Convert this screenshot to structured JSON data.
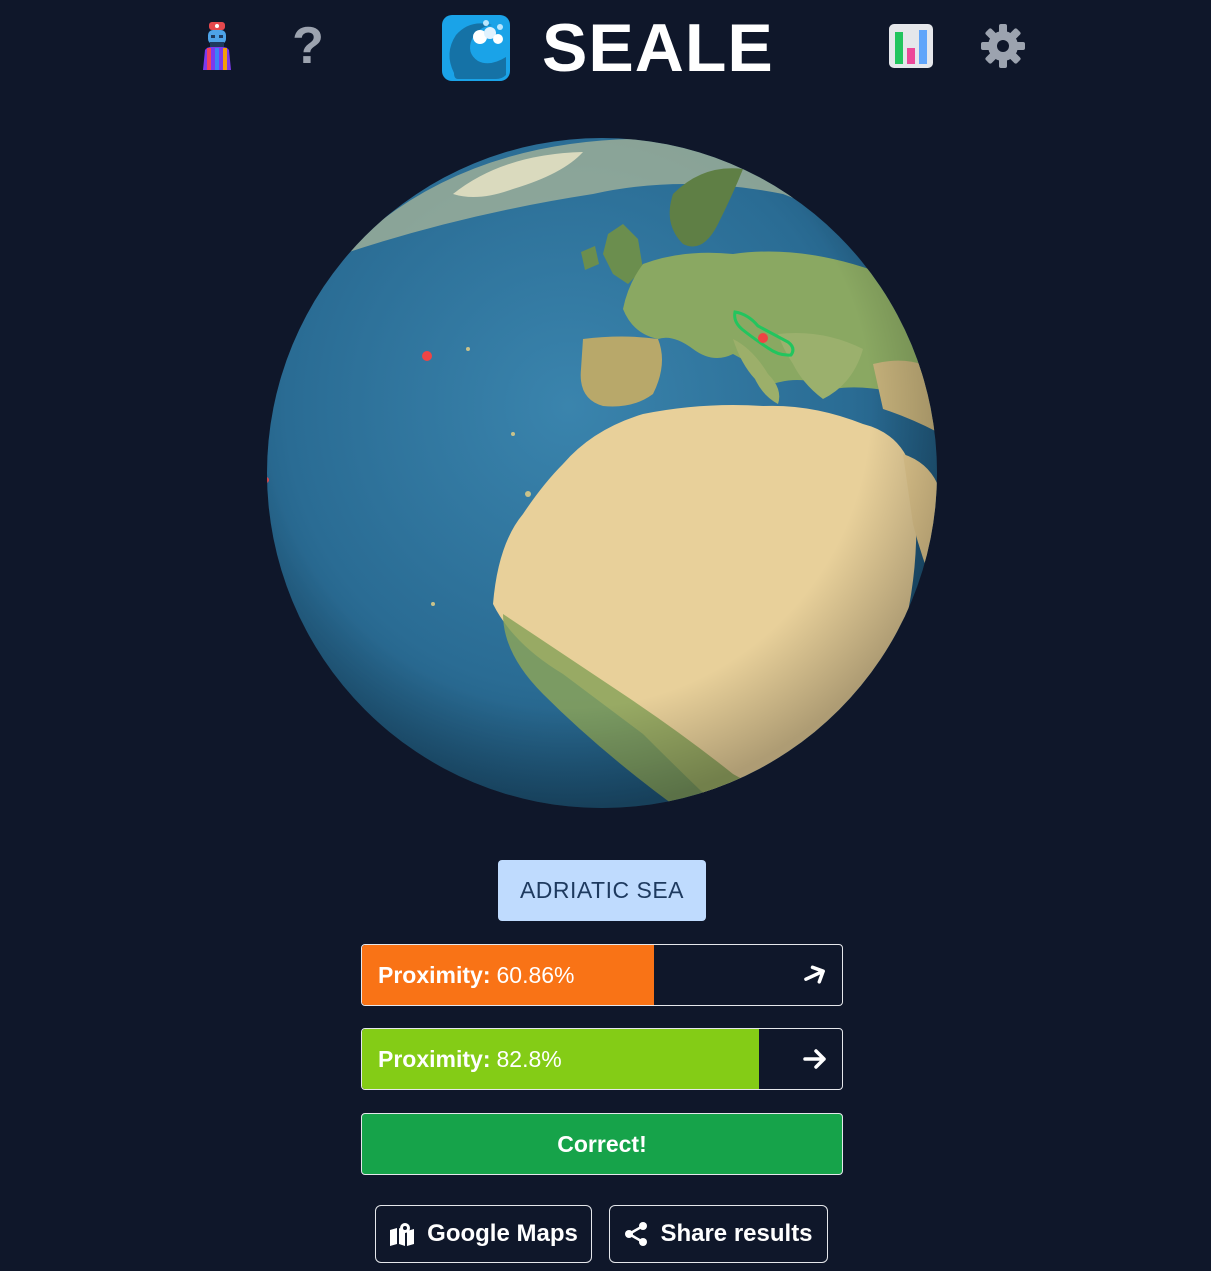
{
  "header": {
    "title": "SEALE",
    "icons": {
      "avatar": "avatar-icon",
      "help": "help-icon",
      "logo": "wave-logo-icon",
      "stats": "stats-icon",
      "settings": "gear-icon"
    },
    "help_glyph": "?"
  },
  "globe": {
    "highlighted_region": "green outline (target sea)",
    "guess_markers": 3,
    "colors": {
      "ocean": "#2a6c94",
      "land": "#e8d09a",
      "outline": "#22c55e",
      "marker": "#ef4444"
    }
  },
  "answer": {
    "label": "ADRIATIC SEA"
  },
  "guesses": [
    {
      "label": "Proximity:",
      "value": "60.86%",
      "percent": 60.86,
      "color": "#f97316"
    },
    {
      "label": "Proximity:",
      "value": "82.8%",
      "percent": 82.8,
      "color": "#84cc16"
    }
  ],
  "result": {
    "label": "Correct!",
    "color": "#16a34a"
  },
  "actions": {
    "maps_label": "Google Maps",
    "share_label": "Share results"
  },
  "colors": {
    "background": "#0f172a",
    "answer_bg": "#bfdbfe"
  }
}
